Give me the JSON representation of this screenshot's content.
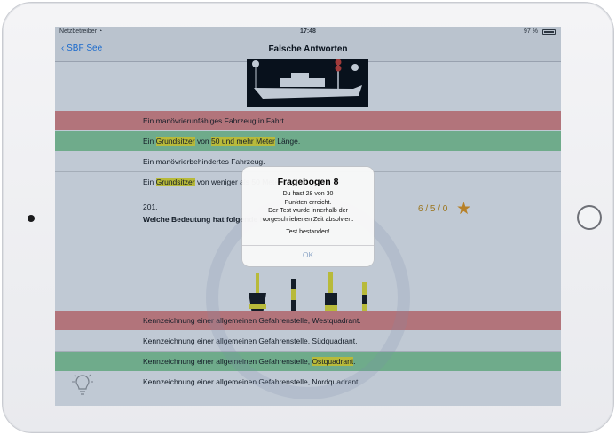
{
  "status_bar": {
    "carrier": "Netzbetreiber",
    "time": "17:48",
    "battery": "97 %"
  },
  "nav": {
    "back_label": "SBF See",
    "title": "Falsche Antworten"
  },
  "question_prev": {
    "answers": [
      {
        "parts": [
          "Ein manövrierunfähiges Fahrzeug in Fahrt."
        ],
        "state": "wrong"
      },
      {
        "parts": [
          "Ein ",
          "Grundsitzer",
          " von ",
          "50 und mehr Meter",
          " Länge."
        ],
        "state": "correct"
      },
      {
        "parts": [
          "Ein manövrierbehindertes Fahrzeug."
        ],
        "state": "neutral"
      },
      {
        "parts": [
          "Ein ",
          "Grundsitzer",
          " von weniger als 50 Meter Länge."
        ],
        "state": "neutral"
      }
    ]
  },
  "question": {
    "number": "201.",
    "text": "Welche Bedeutung hat folgende Kennzeichnung?",
    "score": "6 / 5 / 0",
    "answers": [
      {
        "parts": [
          "Kennzeichnung einer allgemeinen Gefahrenstelle, Westquadrant."
        ],
        "state": "wrong"
      },
      {
        "parts": [
          "Kennzeichnung einer allgemeinen Gefahrenstelle, Südquadrant."
        ],
        "state": "neutral"
      },
      {
        "parts": [
          "Kennzeichnung einer allgemeinen Gefahrenstelle, ",
          "Ostquadrant",
          "."
        ],
        "state": "correct"
      },
      {
        "parts": [
          "Kennzeichnung einer allgemeinen Gefahrenstelle, Nordquadrant."
        ],
        "state": "neutral"
      }
    ]
  },
  "alert": {
    "title": "Fragebogen 8",
    "message_lines": [
      "Du hast 28 von 30",
      "Punkten erreicht.",
      "Der Test wurde innerhalb der",
      "vorgeschriebenen Zeit absolviert."
    ],
    "result": "Test bestanden!",
    "button": "OK"
  },
  "colors": {
    "wrong": "#ec8a84",
    "correct": "#8fd69a",
    "highlight": "#f4ea2a",
    "accent": "#1a7cf5",
    "star": "#f39c12"
  },
  "icons": [
    "chevron-left-icon",
    "wifi-icon",
    "battery-icon",
    "star-icon",
    "lightbulb-icon"
  ]
}
